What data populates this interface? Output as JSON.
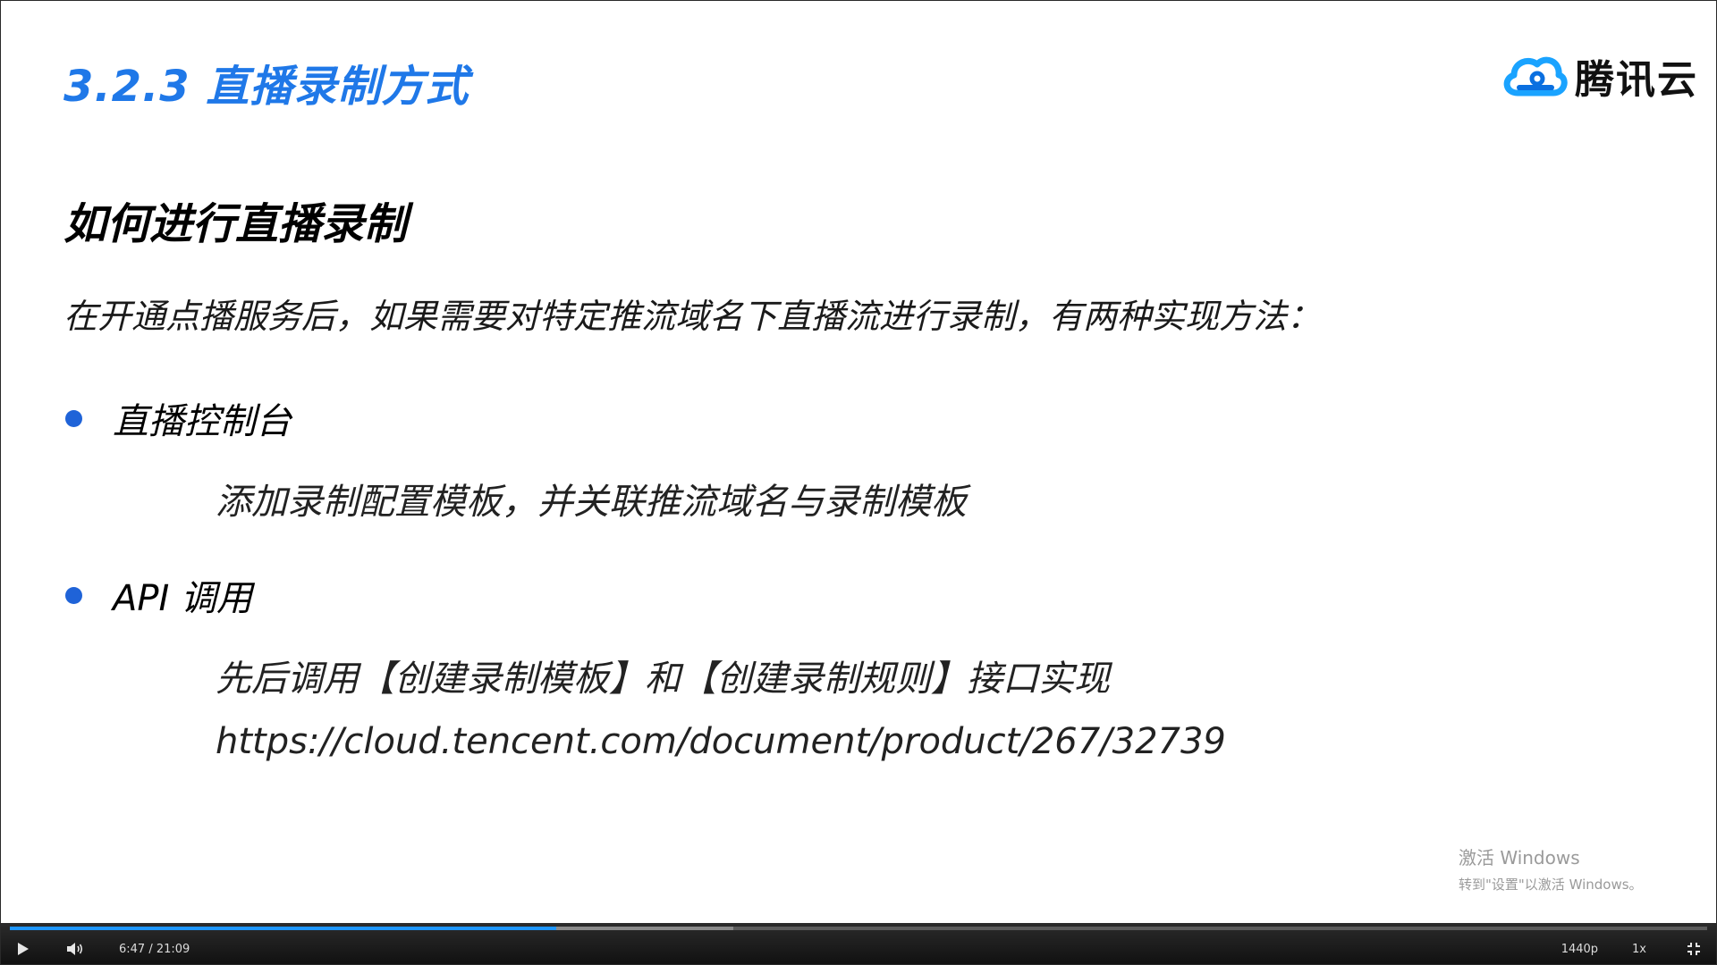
{
  "slide": {
    "section_title": "3.2.3 直播录制方式",
    "logo_text": "腾讯云",
    "heading": "如何进行直播录制",
    "intro": "在开通点播服务后，如果需要对特定推流域名下直播流进行录制，有两种实现方法：",
    "bullets": [
      {
        "label": "直播控制台",
        "lines": [
          "添加录制配置模板，并关联推流域名与录制模板"
        ]
      },
      {
        "label": "API 调用",
        "lines": [
          "先后调用【创建录制模板】和【创建录制规则】接口实现",
          "https://cloud.tencent.com/document/product/267/32739"
        ]
      }
    ]
  },
  "watermark": {
    "line1": "激活 Windows",
    "line2": "转到\"设置\"以激活 Windows。"
  },
  "player": {
    "time": "6:47 / 21:09",
    "quality": "1440p",
    "speed": "1x",
    "played_fraction": 0.322,
    "buffered_fraction": 0.426,
    "accent_color": "#1e96ff"
  },
  "colors": {
    "title": "#1f78e8",
    "bullet": "#1f63d8"
  },
  "icons": {
    "logo": "tencent-cloud-icon",
    "play": "play-icon",
    "volume": "volume-icon",
    "fullscreen": "fullscreen-exit-icon"
  }
}
